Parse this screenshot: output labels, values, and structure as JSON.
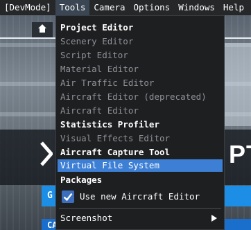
{
  "menubar": {
    "items": [
      "[DevMode]",
      "Tools",
      "Camera",
      "Options",
      "Windows",
      "Help"
    ],
    "active": "Tools"
  },
  "tools_menu": {
    "items": [
      {
        "label": "Project Editor",
        "enabled": true,
        "bold": true
      },
      {
        "label": "Scenery Editor",
        "enabled": false
      },
      {
        "label": "Script Editor",
        "enabled": false
      },
      {
        "label": "Material Editor",
        "enabled": false
      },
      {
        "label": "Air Traffic Editor",
        "enabled": false
      },
      {
        "label": "Aircraft Editor (deprecated)",
        "enabled": false
      },
      {
        "label": "Aircraft Editor",
        "enabled": false
      },
      {
        "label": "Statistics Profiler",
        "enabled": true,
        "bold": true
      },
      {
        "label": "Visual Effects Editor",
        "enabled": false
      },
      {
        "label": "Aircraft Capture Tool",
        "enabled": true,
        "bold": true
      },
      {
        "label": "Virtual File System",
        "enabled": true,
        "selected": true
      },
      {
        "label": "Packages",
        "enabled": true,
        "bold": true
      }
    ],
    "checkbox": {
      "label": "Use new Aircraft Editor",
      "checked": true
    },
    "submenu": {
      "label": "Screenshot",
      "icon": "chevron-right-icon"
    }
  },
  "background": {
    "banner_text": "PT",
    "button1": "G",
    "button2": "CAMERA"
  },
  "colors": {
    "menubar_bg": "#252729",
    "menu_bg": "#1e1f21",
    "highlight": "#3d7fd4",
    "checkbox": "#3b6fbe",
    "disabled_text": "#8e9196",
    "accent_blue": "#1c8ee6"
  }
}
